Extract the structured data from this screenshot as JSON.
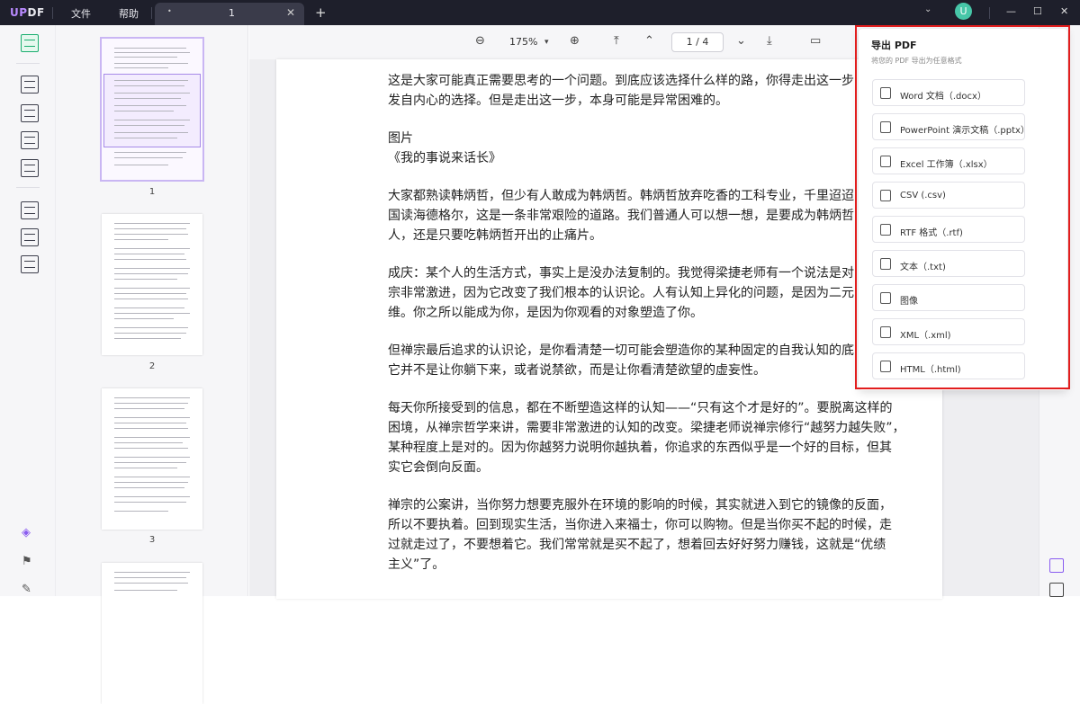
{
  "app": {
    "logo_up": "UP",
    "logo_df": "DF",
    "menu": [
      "文件",
      "帮助"
    ],
    "tab_name": "1",
    "tab_dot": "•",
    "avatar": "U"
  },
  "toolbar": {
    "zoom": "175%",
    "page_current": "1",
    "page_sep": "/",
    "page_total": "4"
  },
  "thumbs": [
    "1",
    "2",
    "3"
  ],
  "document": {
    "paragraphs": [
      [
        "这是大家可能真正需要思考的一个问题。到底应该选择什么样的路，你得走出这一步",
        "发自内心的选择。但是走出这一步，本身可能是异常困难的。"
      ],
      [
        "图片",
        "《我的事说来话长》"
      ],
      [
        "大家都熟读韩炳哲，但少有人敢成为韩炳哲。韩炳哲放弃吃香的工科专业，千里迢迢",
        "国读海德格尔，这是一条非常艰险的道路。我们普通人可以想一想，是要成为韩炳哲",
        "人，还是只要吃韩炳哲开出的止痛片。"
      ],
      [
        "成庆：某个人的生活方式，事实上是没办法复制的。我觉得梁捷老师有一个说法是对",
        "宗非常激进，因为它改变了我们根本的认识论。人有认知上异化的问题，是因为二元",
        "维。你之所以能成为你，是因为你观看的对象塑造了你。"
      ],
      [
        "但禅宗最后追求的认识论，是你看清楚一切可能会塑造你的某种固定的自我认知的底",
        "它并不是让你躺下来，或者说禁欲，而是让你看清楚欲望的虚妄性。"
      ],
      [
        "每天你所接受到的信息，都在不断塑造这样的认知——“只有这个才是好的”。要脱离这样的",
        "困境，从禅宗哲学来讲，需要非常激进的认知的改变。梁捷老师说禅宗修行“越努力越失败”，",
        "某种程度上是对的。因为你越努力说明你越执着，你追求的东西似乎是一个好的目标，但其",
        "实它会倒向反面。"
      ],
      [
        "禅宗的公案讲，当你努力想要克服外在环境的影响的时候，其实就进入到它的镜像的反面，",
        "所以不要执着。回到现实生活，当你进入来福士，你可以购物。但是当你买不起的时候，走",
        "过就走过了，不要想着它。我们常常就是买不起了，想着回去好好努力赚钱，这就是“优绩",
        "主义”了。"
      ]
    ]
  },
  "export_panel": {
    "title": "导出 PDF",
    "subtitle": "将您的 PDF 导出为任意格式",
    "options": [
      "Word 文档（.docx）",
      "PowerPoint 演示文稿（.pptx）",
      "Excel 工作簿（.xlsx）",
      "CSV (.csv)",
      "RTF 格式（.rtf)",
      "文本（.txt)",
      "图像",
      "XML（.xml)",
      "HTML（.html)"
    ]
  },
  "colors": {
    "accent": "#1aae6f",
    "highlight_box": "#e21d1d",
    "avatar": "#47c6a8",
    "titlebar": "#1e1f2b"
  }
}
